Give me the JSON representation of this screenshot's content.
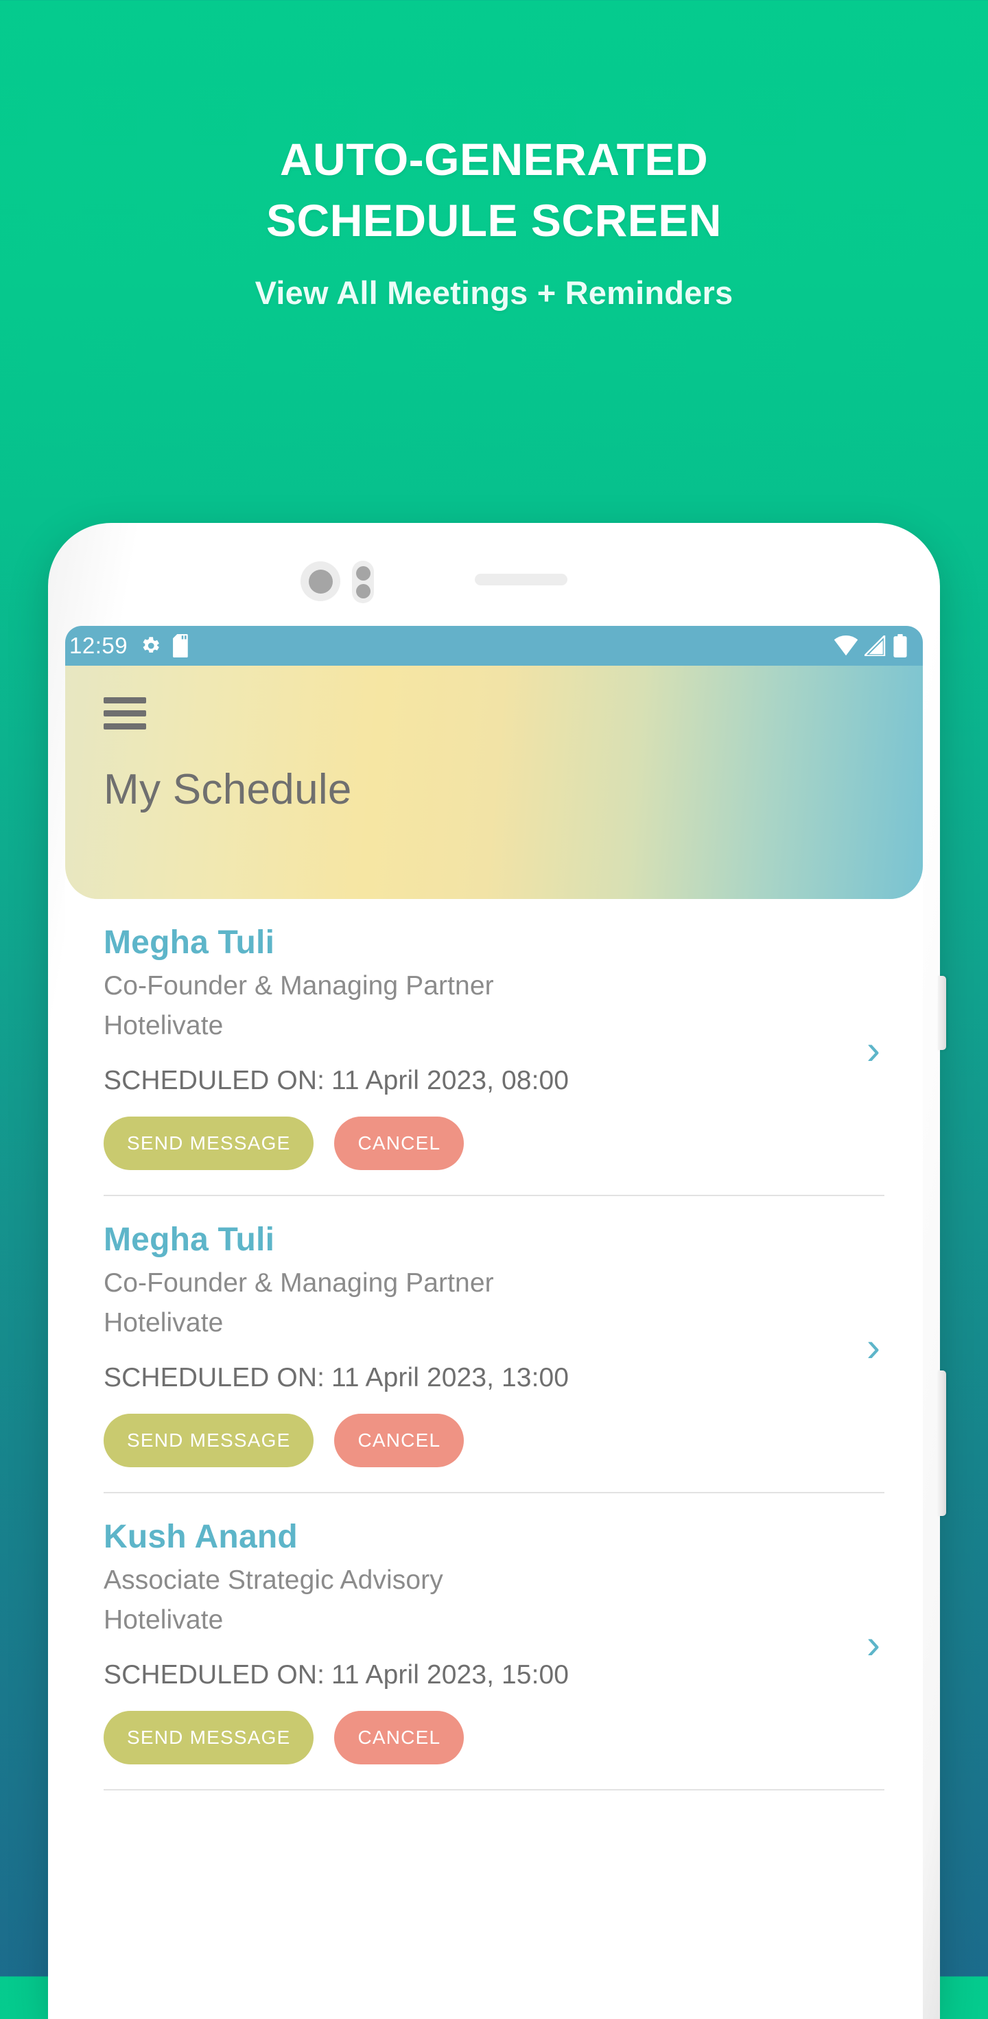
{
  "promo": {
    "title_line1": "AUTO-GENERATED",
    "title_line2": "SCHEDULE SCREEN",
    "subtitle": "View All Meetings + Reminders",
    "bg_top_color": "#05cb8e",
    "bg_bottom_color": "#1c6c8c"
  },
  "phone": {
    "status_bar": {
      "time": "12:59",
      "left_icons": [
        "settings-gear-icon",
        "sd-card-icon"
      ],
      "right_icons": [
        "wifi-icon",
        "signal-icon",
        "battery-icon"
      ],
      "bg_color": "#64b1c9"
    },
    "app_bar": {
      "menu_icon": "hamburger-menu-icon",
      "title": "My Schedule",
      "gradient_from": "#e7e7c2",
      "gradient_mid": "#f6e6a3",
      "gradient_to": "#79c3d2"
    },
    "hardware": {
      "camera_icon": "front-camera-icon",
      "sensor_icon": "proximity-sensor-icon",
      "earpiece_icon": "earpiece-speaker-icon",
      "power_button": "power-button",
      "volume_button": "volume-button"
    }
  },
  "list": {
    "scheduled_label": "SCHEDULED ON:",
    "send_label": "SEND MESSAGE",
    "cancel_label": "CANCEL",
    "chevron_glyph": "›",
    "accent_name_color": "#5db5c9",
    "send_color": "#c9ca6f",
    "cancel_color": "#ef9384",
    "items": [
      {
        "name": "Megha Tuli",
        "role": "Co-Founder & Managing Partner",
        "company": "Hotelivate",
        "scheduled_on": "11 April 2023, 08:00"
      },
      {
        "name": "Megha Tuli",
        "role": "Co-Founder & Managing Partner",
        "company": "Hotelivate",
        "scheduled_on": "11 April 2023, 13:00"
      },
      {
        "name": "Kush Anand",
        "role": "Associate Strategic Advisory",
        "company": "Hotelivate",
        "scheduled_on": "11 April 2023, 15:00"
      }
    ]
  }
}
